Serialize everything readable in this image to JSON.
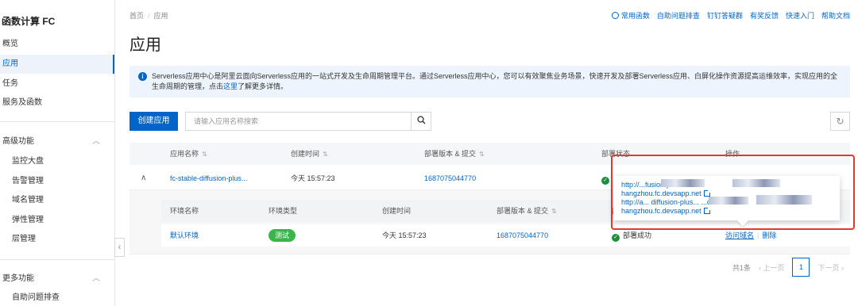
{
  "sidebar": {
    "title": "函数计算 FC",
    "items": [
      {
        "label": "概览"
      },
      {
        "label": "应用"
      },
      {
        "label": "任务"
      },
      {
        "label": "服务及函数"
      }
    ],
    "group_advanced": {
      "label": "高级功能",
      "items": [
        {
          "label": "监控大盘"
        },
        {
          "label": "告警管理"
        },
        {
          "label": "域名管理"
        },
        {
          "label": "弹性管理"
        },
        {
          "label": "层管理"
        }
      ]
    },
    "group_more": {
      "label": "更多功能",
      "items": [
        {
          "label": "自助问题排查"
        }
      ]
    }
  },
  "header": {
    "breadcrumb": [
      "首页",
      "应用"
    ],
    "title": "应用",
    "links": [
      "常用函数",
      "自助问题排查",
      "钉钉答疑群",
      "有奖反馈",
      "快速入门",
      "帮助文档"
    ]
  },
  "banner": {
    "text": "Serverless应用中心是阿里云面向Serverless应用的一站式开发及生命周期管理平台。通过Serverless应用中心，您可以有效聚焦业务场景，快速开发及部署Serverless应用、白屏化操作资源提高运维效率，实现应用的全生命周期的管理，点击",
    "link": "这里",
    "suffix": "了解更多详情。"
  },
  "toolbar": {
    "create_label": "创建应用",
    "search_placeholder": "请输入应用名称搜索"
  },
  "table": {
    "headers": [
      "应用名称",
      "创建时间",
      "部署版本 & 提交",
      "部署状态",
      "操作"
    ],
    "rows": [
      {
        "name": "fc-stable-diffusion-plus...",
        "created": "今天 15:57:23",
        "version": "1687075044770"
      }
    ]
  },
  "subtable": {
    "headers": [
      "环境名称",
      "环境类型",
      "创建时间",
      "部署版本 & 提交",
      "部署状态"
    ],
    "rows": [
      {
        "env": "默认环境",
        "type": "测试",
        "created": "今天 15:57:23",
        "version": "1687075044770",
        "status": "部署成功",
        "action_domain": "访问域名",
        "action_delete": "删除"
      }
    ]
  },
  "popover": {
    "line1": "http://...fusion-plus...cn-",
    "line1b": "hangzhou.fc.devsapp.net",
    "line2": "http://a... diffusion-plus... ...cn-",
    "line2b": "hangzhou.fc.devsapp.net"
  },
  "pager": {
    "total": "共1条",
    "prev": "上一页",
    "page": "1",
    "next": "下一页"
  }
}
